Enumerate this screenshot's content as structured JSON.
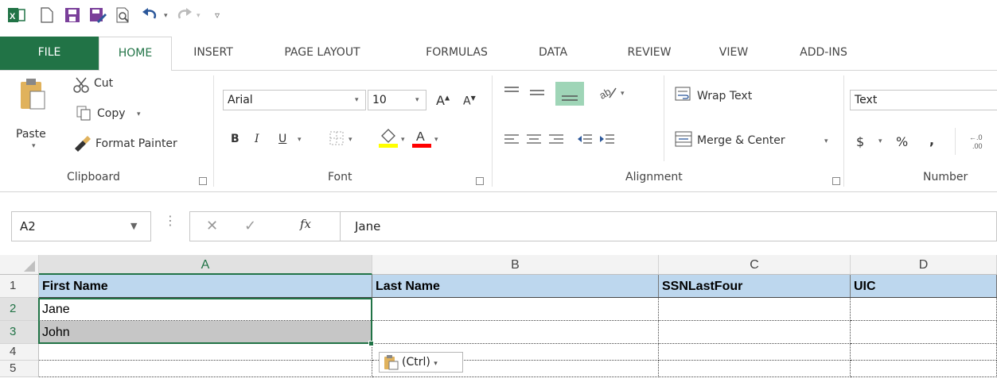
{
  "quick_access": {
    "app_icon": "excel-icon",
    "new_icon": "new-document-icon",
    "save_icon": "save-icon",
    "save_as_icon": "save-as-icon",
    "print_preview_icon": "print-preview-icon",
    "undo_icon": "undo-icon",
    "redo_icon": "redo-icon",
    "customize_icon": "customize-icon"
  },
  "tabs": [
    {
      "label": "FILE"
    },
    {
      "label": "HOME"
    },
    {
      "label": "INSERT"
    },
    {
      "label": "PAGE LAYOUT"
    },
    {
      "label": "FORMULAS"
    },
    {
      "label": "DATA"
    },
    {
      "label": "REVIEW"
    },
    {
      "label": "VIEW"
    },
    {
      "label": "ADD-INS"
    }
  ],
  "ribbon": {
    "clipboard": {
      "paste": "Paste",
      "cut": "Cut",
      "copy": "Copy",
      "format_painter": "Format Painter",
      "group_label": "Clipboard"
    },
    "font": {
      "font_name": "Arial",
      "font_size": "10",
      "bold": "B",
      "italic": "I",
      "underline": "U",
      "group_label": "Font"
    },
    "alignment": {
      "wrap_text": "Wrap Text",
      "merge_center": "Merge & Center",
      "group_label": "Alignment"
    },
    "number": {
      "format": "Text",
      "currency": "$",
      "percent": "%",
      "comma": ",",
      "group_label": "Number"
    }
  },
  "formula_bar": {
    "name_box": "A2",
    "fx": "fx",
    "value": "Jane"
  },
  "grid": {
    "columns": [
      "A",
      "B",
      "C",
      "D"
    ],
    "rows": [
      "1",
      "2",
      "3",
      "4",
      "5"
    ],
    "cells": [
      [
        "First Name",
        "Last Name",
        "SSNLastFour",
        "UIC"
      ],
      [
        "Jane",
        "",
        "",
        ""
      ],
      [
        "John",
        "",
        "",
        ""
      ],
      [
        "",
        "",
        "",
        ""
      ],
      [
        "",
        "",
        "",
        ""
      ]
    ],
    "paste_options": "(Ctrl)"
  },
  "colors": {
    "accent": "#217346",
    "header_fill": "#BDD7EE",
    "font_color_bar": "#FF0000",
    "highlight_bar": "#FFFF00"
  }
}
